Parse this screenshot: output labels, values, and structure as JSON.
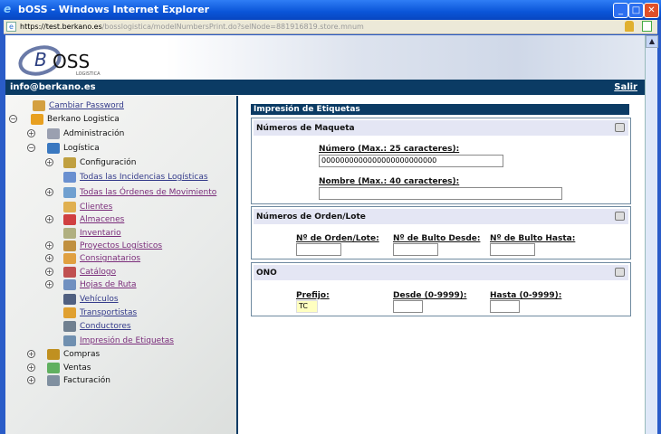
{
  "window": {
    "title": "bOSS - Windows Internet Explorer",
    "url_scheme": "https://",
    "url_host": "test.berkano.es",
    "url_path": "/bosslogistica/modelNumbersPrint.do?selNode=881916819.store.mnum"
  },
  "header": {
    "logo_text": "BOSS",
    "logo_sub": "LOGISTICA",
    "user": "info@berkano.es",
    "logout": "Salir"
  },
  "sidebar": {
    "items": [
      {
        "label": "Cambiar Password",
        "style": "link",
        "level": 1,
        "expander": ""
      },
      {
        "label": "Berkano Logistica",
        "style": "plain",
        "level": 0,
        "expander": "minus"
      },
      {
        "label": "Administración",
        "style": "plain",
        "level": 1,
        "expander": "plus"
      },
      {
        "label": "Logística",
        "style": "plain",
        "level": 1,
        "expander": "minus"
      },
      {
        "label": "Configuración",
        "style": "plain",
        "level": 2,
        "expander": "plus"
      },
      {
        "label": "Todas las Incidencias Logísticas",
        "style": "link",
        "level": 2,
        "expander": ""
      },
      {
        "label": "Todas las Órdenes de Movimiento",
        "style": "visited",
        "level": 2,
        "expander": "plus"
      },
      {
        "label": "Clientes",
        "style": "visited",
        "level": 2,
        "expander": ""
      },
      {
        "label": "Almacenes",
        "style": "visited",
        "level": 2,
        "expander": "plus"
      },
      {
        "label": "Inventario",
        "style": "visited",
        "level": 2,
        "expander": ""
      },
      {
        "label": "Proyectos Logísticos",
        "style": "visited",
        "level": 2,
        "expander": "plus"
      },
      {
        "label": "Consignatarios",
        "style": "visited",
        "level": 2,
        "expander": "plus"
      },
      {
        "label": "Catálogo",
        "style": "visited",
        "level": 2,
        "expander": "plus"
      },
      {
        "label": "Hojas de Ruta",
        "style": "visited",
        "level": 2,
        "expander": "plus"
      },
      {
        "label": "Vehículos",
        "style": "link",
        "level": 2,
        "expander": ""
      },
      {
        "label": "Transportistas",
        "style": "link",
        "level": 2,
        "expander": ""
      },
      {
        "label": "Conductores",
        "style": "link",
        "level": 2,
        "expander": ""
      },
      {
        "label": "Impresión de Etiquetas",
        "style": "visited",
        "level": 2,
        "expander": ""
      },
      {
        "label": "Compras",
        "style": "plain",
        "level": 1,
        "expander": "plus"
      },
      {
        "label": "Ventas",
        "style": "plain",
        "level": 1,
        "expander": "plus"
      },
      {
        "label": "Facturación",
        "style": "plain",
        "level": 1,
        "expander": "plus"
      }
    ]
  },
  "main": {
    "title": "Impresión de Etiquetas",
    "maqueta": {
      "title": "Números de Maqueta",
      "numero_label": "Número (Max.: 25 caracteres):",
      "numero_value": "0000000000000000000000000",
      "nombre_label": "Nombre (Max.: 40 caracteres):",
      "nombre_value": ""
    },
    "orden": {
      "title": "Números de Orden/Lote",
      "orden_label": "Nº de Orden/Lote:",
      "desde_label": "Nº de Bulto Desde:",
      "hasta_label": "Nº de Bulto Hasta:",
      "orden_value": "",
      "desde_value": "",
      "hasta_value": ""
    },
    "ono": {
      "title": "ONO",
      "prefijo_label": "Prefijo:",
      "prefijo_value": "TC",
      "desde_label": "Desde (0-9999):",
      "hasta_label": "Hasta (0-9999):",
      "desde_value": "",
      "hasta_value": ""
    }
  },
  "colors": {
    "header_bar": "#0b3b64",
    "section_head": "#e4e6f4",
    "link": "#333a8a",
    "visited": "#7a2c7a",
    "prefijo_bg": "#ffffc0"
  }
}
